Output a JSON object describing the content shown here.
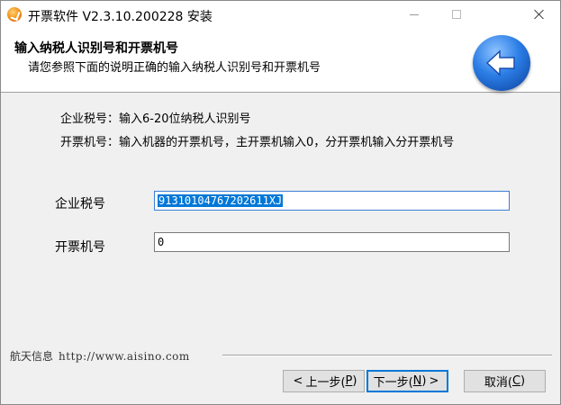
{
  "window": {
    "title": "开票软件 V2.3.10.200228 安装"
  },
  "header": {
    "title": "输入纳税人识别号和开票机号",
    "subtitle": "请您参照下面的说明正确的输入纳税人识别号和开票机号",
    "icon": "back-arrow-icon"
  },
  "instructions": {
    "tax_id_help": "企业税号：输入6-20位纳税人识别号",
    "machine_help": "开票机号：输入机器的开票机号，主开票机输入0，分开票机输入分开票机号"
  },
  "form": {
    "tax_id_label": "企业税号",
    "tax_id_value": "91310104767202611XJ",
    "machine_label": "开票机号",
    "machine_value": "0"
  },
  "footer": {
    "brand": "航天信息",
    "url": "http://www.aisino.com"
  },
  "buttons": {
    "back_arrow": "<",
    "back_label": "上一步(",
    "back_key": "P",
    "back_end": ")",
    "next_label": "下一步(",
    "next_key": "N",
    "next_end": ")",
    "next_arrow": ">",
    "cancel_label": "取消(",
    "cancel_key": "C",
    "cancel_end": ")"
  }
}
